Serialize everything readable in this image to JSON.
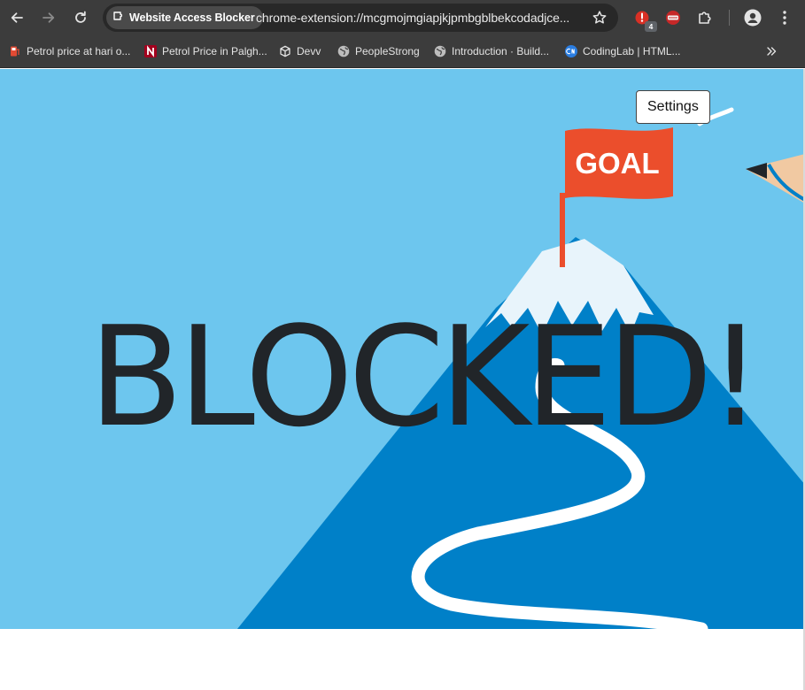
{
  "browser": {
    "tab_title": "Website Access Blocker",
    "url": "chrome-extension://mcgmojmgiapjkjpmbgblbekcodadjce...",
    "extension_badge_count": "4",
    "icons": [
      "back-icon",
      "forward-icon",
      "reload-icon",
      "extension-page-icon",
      "bookmark-star-icon",
      "extension-icon",
      "extensions-puzzle-icon",
      "profile-icon",
      "menu-icon"
    ]
  },
  "bookmarks": [
    {
      "label": "Petrol price at hari o...",
      "icon": "fuel-icon"
    },
    {
      "label": "Petrol Price in Palgh...",
      "icon": "n-logo-icon"
    },
    {
      "label": "Devv",
      "icon": "cube-icon"
    },
    {
      "label": "PeopleStrong",
      "icon": "globe-icon"
    },
    {
      "label": "Introduction · Build...",
      "icon": "globe-icon"
    },
    {
      "label": "CodingLab | HTML...",
      "icon": "codinglab-icon"
    }
  ],
  "page": {
    "heading": "BLOCKED!",
    "settings_label": "Settings",
    "flag_text": "GOAL",
    "colors": {
      "sky": "#6dc6ee",
      "mountain": "#0080c8",
      "flag": "#eb4e2c",
      "snow": "#e8f4fb",
      "heading": "#212529"
    }
  }
}
